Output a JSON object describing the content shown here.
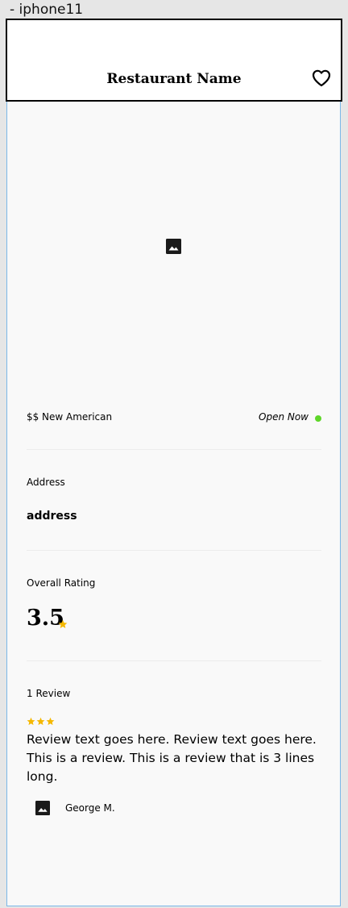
{
  "frame": {
    "label": "- iphone11"
  },
  "header": {
    "title": "Restaurant Name",
    "favorite_icon": "heart-outline-icon"
  },
  "hero": {
    "icon": "image-icon"
  },
  "meta": {
    "price": "$$",
    "cuisine": "New American",
    "status": "Open Now",
    "status_color": "#5ed62a"
  },
  "address": {
    "label": "Address",
    "value": "address"
  },
  "overall": {
    "label": "Overall Rating",
    "value": "3.5",
    "star_color": "#f5b800"
  },
  "reviews": {
    "count_label": "1 Review",
    "items": [
      {
        "stars": 3,
        "text": "Review text goes here. Review text goes here. This is a review. This is a review that is 3 lines long.",
        "author": "George M."
      }
    ]
  }
}
